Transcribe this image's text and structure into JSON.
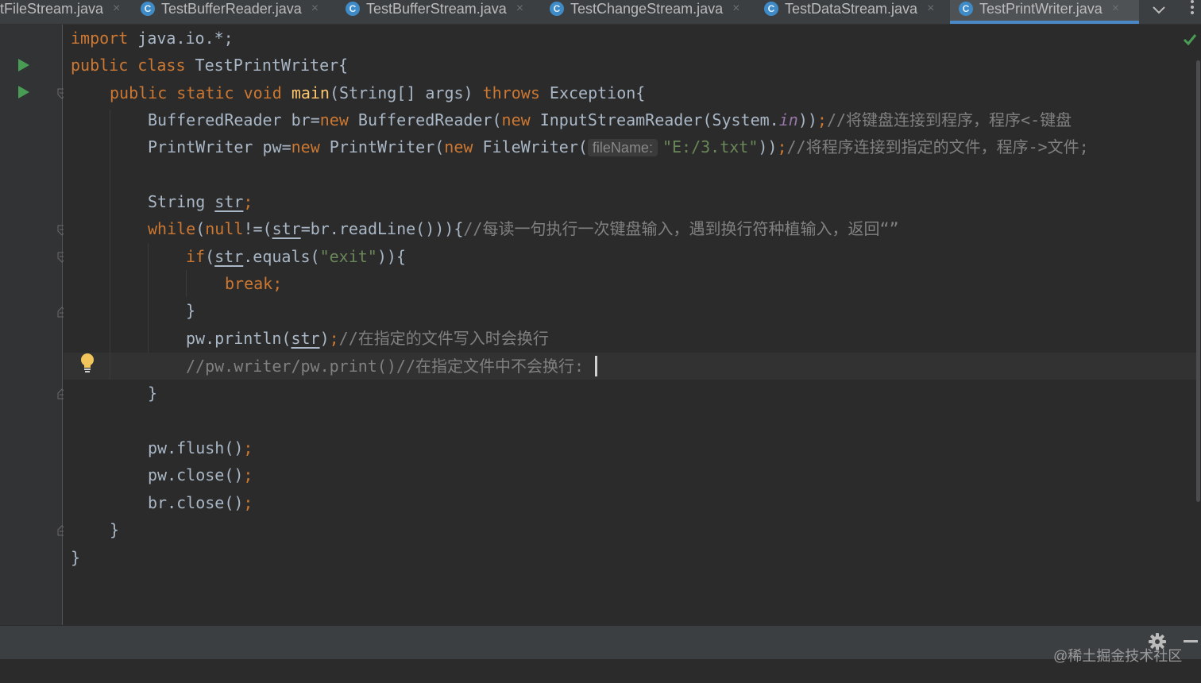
{
  "tabs": [
    {
      "label": "tFileStream.java",
      "close": "×",
      "icon": "java-class-icon"
    },
    {
      "label": "TestBufferReader.java",
      "close": "×",
      "icon": "java-class-icon"
    },
    {
      "label": "TestBufferStream.java",
      "close": "×",
      "icon": "java-class-icon"
    },
    {
      "label": "TestChangeStream.java",
      "close": "×",
      "icon": "java-class-icon"
    },
    {
      "label": "TestDataStream.java",
      "close": "×",
      "icon": "java-class-icon"
    },
    {
      "label": "TestPrintWriter.java",
      "close": "×",
      "icon": "java-class-icon",
      "active": true
    }
  ],
  "class_icon_letter": "C",
  "code": {
    "l1": {
      "kw": "import",
      "rest": " java.io.*;"
    },
    "l2": {
      "kw1": "public",
      "kw2": "class",
      "name": " TestPrintWriter{"
    },
    "l3": {
      "kw1": "public",
      "kw2": "static",
      "kw3": "void",
      "fn": "main",
      "params": "(String[] args) ",
      "kw4": "throws",
      "rest": " Exception{"
    },
    "l4": {
      "a": "BufferedReader br=",
      "new1": "new",
      "b": " BufferedReader(",
      "new2": "new",
      "c": " InputStreamReader(System.",
      "st": "in",
      "d": "))",
      "semi": ";",
      "comment": "//将键盘连接到程序，程序<-键盘"
    },
    "l5": {
      "a": "PrintWriter pw=",
      "new1": "new",
      "b": " PrintWriter(",
      "new2": "new",
      "c": " FileWriter(",
      "hint": "fileName:",
      "str": "\"E:/3.txt\"",
      "d": "))",
      "semi": ";",
      "comment": "//将程序连接到指定的文件，程序->文件;"
    },
    "l6": {
      "type": "String ",
      "var": "str",
      "semi": ";"
    },
    "l7": {
      "kw1": "while",
      "a": "(",
      "kw2": "null",
      "b": "!=(",
      "var": "str",
      "c": "=br.readLine())){",
      "comment": "//每读一句执行一次键盘输入，遇到换行符种植输入，返回“”"
    },
    "l8": {
      "kw": "if",
      "a": "(",
      "var": "str",
      "b": ".equals(",
      "str": "\"exit\"",
      "c": ")){"
    },
    "l9": {
      "kw": "break",
      "semi": ";"
    },
    "l10": {
      "text": "}"
    },
    "l11": {
      "a": "pw.println(",
      "var": "str",
      "b": ")",
      "semi": ";",
      "comment": "//在指定的文件写入时会换行"
    },
    "l12": {
      "comment": "//pw.writer/pw.print()//在指定文件中不会换行:"
    },
    "l13": {
      "text": "}"
    },
    "l14": {
      "a": "pw.flush()",
      "semi": ";"
    },
    "l15": {
      "a": "pw.close()",
      "semi": ";"
    },
    "l16": {
      "a": "br.close()",
      "semi": ";"
    },
    "l17": {
      "text": "}"
    },
    "l18": {
      "text": "}"
    }
  },
  "watermark": "@稀土掘金技术社区",
  "colors": {
    "keyword": "#cc7832",
    "function": "#ffc66d",
    "string": "#6a8759",
    "comment": "#808080",
    "static": "#9876aa",
    "text": "#a9b7c6",
    "active_tab_underline": "#4a88c7"
  }
}
